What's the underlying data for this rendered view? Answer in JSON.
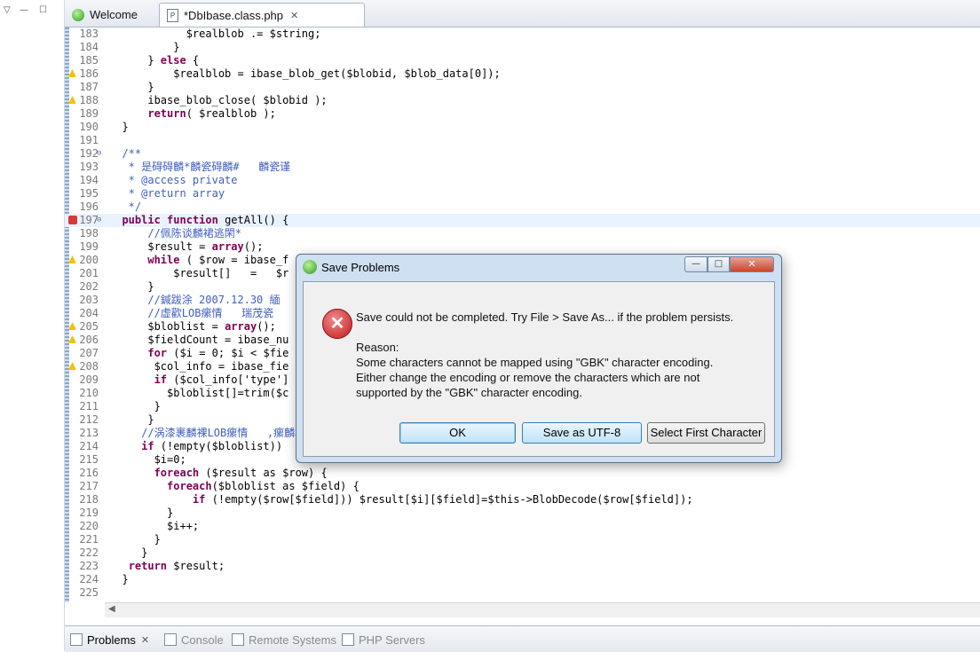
{
  "editor_tabs": [
    {
      "label": "Welcome"
    },
    {
      "label": "*DbIbase.class.php"
    }
  ],
  "code_lines": [
    {
      "num": "183",
      "text": "            $realblob .= $string;",
      "mark": ""
    },
    {
      "num": "184",
      "text": "          }",
      "mark": ""
    },
    {
      "num": "185",
      "text": "      } else {",
      "mark": ""
    },
    {
      "num": "186",
      "text": "          $realblob = ibase_blob_get($blobid, $blob_data[0]);",
      "mark": "warn"
    },
    {
      "num": "187",
      "text": "      }",
      "mark": ""
    },
    {
      "num": "188",
      "text": "      ibase_blob_close( $blobid );",
      "mark": "warn"
    },
    {
      "num": "189",
      "text": "      return( $realblob );",
      "mark": ""
    },
    {
      "num": "190",
      "text": "  }",
      "mark": ""
    },
    {
      "num": "191",
      "text": "",
      "mark": ""
    },
    {
      "num": "192",
      "text": "  /**",
      "mark": "",
      "fold": "⊖"
    },
    {
      "num": "193",
      "text": "   * 是碍碍麟*麟瓷碍麟#   麟瓷谨",
      "mark": ""
    },
    {
      "num": "194",
      "text": "   * @access private",
      "mark": ""
    },
    {
      "num": "195",
      "text": "   * @return array",
      "mark": ""
    },
    {
      "num": "196",
      "text": "   */",
      "mark": ""
    },
    {
      "num": "197",
      "text": "  public function getAll() {",
      "mark": "err",
      "fold": "⊖",
      "current": true
    },
    {
      "num": "198",
      "text": "      //佩陈谈麟裙逃閑*",
      "mark": ""
    },
    {
      "num": "199",
      "text": "      $result = array();",
      "mark": ""
    },
    {
      "num": "200",
      "text": "      while ( $row = ibase_f",
      "mark": "warn"
    },
    {
      "num": "201",
      "text": "          $result[]   =   $r",
      "mark": ""
    },
    {
      "num": "202",
      "text": "      }",
      "mark": ""
    },
    {
      "num": "203",
      "text": "      //鍼跋涂 2007.12.30 緬   麟",
      "mark": ""
    },
    {
      "num": "204",
      "text": "      //虚歡LOB瘰情   瑞茂瓷",
      "mark": ""
    },
    {
      "num": "205",
      "text": "      $bloblist = array();",
      "mark": "warn"
    },
    {
      "num": "206",
      "text": "      $fieldCount = ibase_nu",
      "mark": "warn"
    },
    {
      "num": "207",
      "text": "      for ($i = 0; $i < $fie",
      "mark": ""
    },
    {
      "num": "208",
      "text": "       $col_info = ibase_fie",
      "mark": "warn"
    },
    {
      "num": "209",
      "text": "       if ($col_info['type']",
      "mark": ""
    },
    {
      "num": "210",
      "text": "         $bloblist[]=trim($c",
      "mark": ""
    },
    {
      "num": "211",
      "text": "       }",
      "mark": ""
    },
    {
      "num": "212",
      "text": "      }",
      "mark": ""
    },
    {
      "num": "213",
      "text": "     //涡漆裹麟裸LOB瘰情   ,瘰麟楓瘰丸",
      "mark": ""
    },
    {
      "num": "214",
      "text": "     if (!empty($bloblist))",
      "mark": ""
    },
    {
      "num": "215",
      "text": "       $i=0;",
      "mark": ""
    },
    {
      "num": "216",
      "text": "       foreach ($result as $row) {",
      "mark": ""
    },
    {
      "num": "217",
      "text": "         foreach($bloblist as $field) {",
      "mark": ""
    },
    {
      "num": "218",
      "text": "             if (!empty($row[$field])) $result[$i][$field]=$this->BlobDecode($row[$field]);",
      "mark": ""
    },
    {
      "num": "219",
      "text": "         }",
      "mark": ""
    },
    {
      "num": "220",
      "text": "         $i++;",
      "mark": ""
    },
    {
      "num": "221",
      "text": "       }",
      "mark": ""
    },
    {
      "num": "222",
      "text": "     }",
      "mark": ""
    },
    {
      "num": "223",
      "text": "   return $result;",
      "mark": ""
    },
    {
      "num": "224",
      "text": "  }",
      "mark": ""
    },
    {
      "num": "225",
      "text": "",
      "mark": ""
    }
  ],
  "views": [
    {
      "label": "Problems"
    },
    {
      "label": "Console"
    },
    {
      "label": "Remote Systems"
    },
    {
      "label": "PHP Servers"
    }
  ],
  "dialog": {
    "title": "Save Problems",
    "message": "Save could not be completed. Try File > Save As... if the problem persists.",
    "reason_label": "Reason:",
    "reason_lines": [
      "Some characters cannot be mapped using \"GBK\" character encoding.",
      "Either change the encoding or remove the characters which are not",
      "supported by the \"GBK\" character encoding."
    ],
    "buttons": {
      "ok": "OK",
      "utf8": "Save as UTF-8",
      "first": "Select First Character"
    },
    "window_controls": {
      "minimize": "—",
      "maximize": "□",
      "close": "✕"
    }
  },
  "icons": {
    "tab_close": "close-icon",
    "error": "error-icon",
    "warning": "warning-icon"
  }
}
